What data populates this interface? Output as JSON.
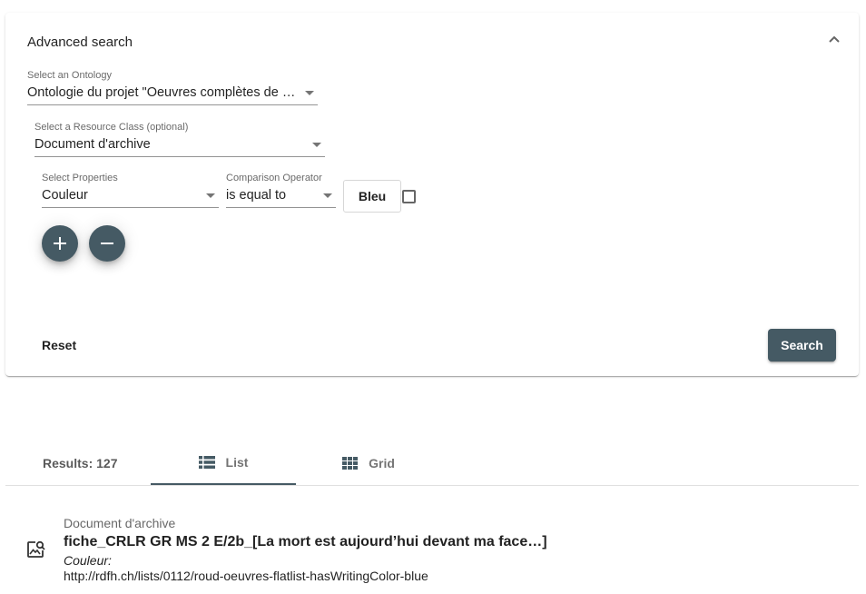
{
  "advanced_search": {
    "title": "Advanced search",
    "ontology": {
      "label": "Select an Ontology",
      "value": "Ontologie du projet \"Oeuvres complètes de Gustave Roud\""
    },
    "resource_class": {
      "label": "Select a Resource Class (optional)",
      "value": "Document d'archive"
    },
    "property": {
      "label": "Select Properties",
      "value": "Couleur"
    },
    "comparison": {
      "label": "Comparison Operator",
      "value": "is equal to"
    },
    "search_value": "Bleu",
    "reset_label": "Reset",
    "search_label": "Search"
  },
  "results": {
    "count_label": "Results: 127",
    "tabs": [
      {
        "label": "List",
        "icon": "list-icon",
        "active": true
      },
      {
        "label": "Grid",
        "icon": "grid-icon",
        "active": false
      }
    ],
    "items": [
      {
        "type": "Document d'archive",
        "title": "fiche_CRLR GR MS 2 E/2b_[La mort est aujourd’hui devant ma face…]",
        "property_label": "Couleur:",
        "property_value": "http://rdfh.ch/lists/0112/roud-oeuvres-flatlist-hasWritingColor-blue",
        "icon": "image-search-icon"
      }
    ]
  },
  "colors": {
    "accent": "#455a64"
  }
}
